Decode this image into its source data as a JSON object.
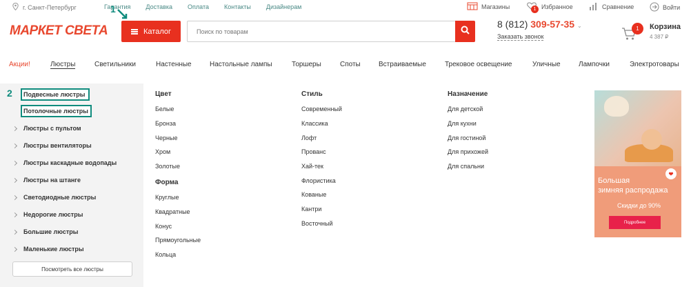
{
  "topbar": {
    "city": "г. Санкт-Петербург",
    "links": [
      "Гарантия",
      "Доставка",
      "Оплата",
      "Контакты",
      "Дизайнерам"
    ],
    "stores": "Магазины",
    "favorites": "Избранное",
    "favorites_count": "1",
    "compare": "Сравнение",
    "login": "Войти"
  },
  "header": {
    "logo": "МАРКЕТ СВЕТА",
    "catalog_label": "Каталог",
    "search_placeholder": "Поиск по товарам",
    "phone_prefix": "8 (812)",
    "phone_number": "309-57-35",
    "callback": "Заказать звонок",
    "cart_title": "Корзина",
    "cart_count": "1",
    "cart_sum": "4 387 ₽"
  },
  "categories": [
    "Акции!",
    "Люстры",
    "Светильники",
    "Настенные",
    "Настольные лампы",
    "Торшеры",
    "Споты",
    "Встраиваемые",
    "Трековое освещение",
    "Уличные",
    "Лампочки",
    "Электротовары"
  ],
  "sidebar": {
    "items": [
      "Подвесные люстры",
      "Потолочные люстры",
      "Люстры с пультом",
      "Люстры вентиляторы",
      "Люстры каскадные водопады",
      "Люстры на штанге",
      "Светодиодные люстры",
      "Недорогие люстры",
      "Большие люстры",
      "Маленькие люстры"
    ],
    "all_button": "Посмотреть все люстры"
  },
  "annotations": {
    "one": "1",
    "two": "2"
  },
  "filters": {
    "color_title": "Цвет",
    "colors": [
      "Белые",
      "Бронза",
      "Черные",
      "Хром",
      "Золотые"
    ],
    "shape_title": "Форма",
    "shapes": [
      "Круглые",
      "Квадратные",
      "Конус",
      "Прямоугольные",
      "Кольца"
    ],
    "style_title": "Стиль",
    "styles": [
      "Современный",
      "Классика",
      "Лофт",
      "Прованс",
      "Хай-тек",
      "Флористика",
      "Кованые",
      "Кантри",
      "Восточный"
    ],
    "purpose_title": "Назначение",
    "purposes": [
      "Для детской",
      "Для кухни",
      "Для гостиной",
      "Для прихожей",
      "Для спальни"
    ]
  },
  "banner": {
    "title_line1": "Большая",
    "title_line2": "зимняя распродажа",
    "subtitle": "Скидки до 90%",
    "button": "Подробнее"
  },
  "colors": {
    "accent": "#e8301f",
    "annotation": "#0f8b7d",
    "link": "#4a8a86"
  }
}
